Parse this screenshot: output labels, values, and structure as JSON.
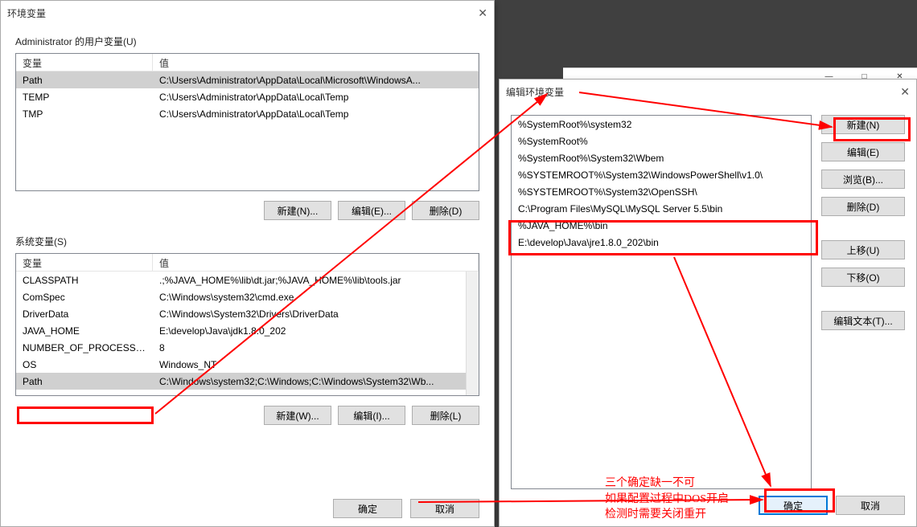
{
  "dialog1": {
    "title": "环境变量",
    "user_section_label": "Administrator 的用户变量(U)",
    "user_vars": {
      "col_name": "变量",
      "col_value": "值",
      "rows": [
        {
          "name": "Path",
          "value": "C:\\Users\\Administrator\\AppData\\Local\\Microsoft\\WindowsA...",
          "selected": true
        },
        {
          "name": "TEMP",
          "value": "C:\\Users\\Administrator\\AppData\\Local\\Temp"
        },
        {
          "name": "TMP",
          "value": "C:\\Users\\Administrator\\AppData\\Local\\Temp"
        }
      ]
    },
    "user_buttons": {
      "new": "新建(N)...",
      "edit": "编辑(E)...",
      "delete": "删除(D)"
    },
    "sys_section_label": "系统变量(S)",
    "sys_vars": {
      "col_name": "变量",
      "col_value": "值",
      "rows": [
        {
          "name": "CLASSPATH",
          "value": ".;%JAVA_HOME%\\lib\\dt.jar;%JAVA_HOME%\\lib\\tools.jar"
        },
        {
          "name": "ComSpec",
          "value": "C:\\Windows\\system32\\cmd.exe"
        },
        {
          "name": "DriverData",
          "value": "C:\\Windows\\System32\\Drivers\\DriverData"
        },
        {
          "name": "JAVA_HOME",
          "value": "E:\\develop\\Java\\jdk1.8.0_202"
        },
        {
          "name": "NUMBER_OF_PROCESSORS",
          "value": "8"
        },
        {
          "name": "OS",
          "value": "Windows_NT"
        },
        {
          "name": "Path",
          "value": "C:\\Windows\\system32;C:\\Windows;C:\\Windows\\System32\\Wb...",
          "selected": true
        }
      ]
    },
    "sys_buttons": {
      "new": "新建(W)...",
      "edit": "编辑(I)...",
      "delete": "删除(L)"
    },
    "ok": "确定",
    "cancel": "取消"
  },
  "dialog2": {
    "title": "编辑环境变量",
    "items": [
      "%SystemRoot%\\system32",
      "%SystemRoot%",
      "%SystemRoot%\\System32\\Wbem",
      "%SYSTEMROOT%\\System32\\WindowsPowerShell\\v1.0\\",
      "%SYSTEMROOT%\\System32\\OpenSSH\\",
      "C:\\Program Files\\MySQL\\MySQL Server 5.5\\bin",
      "%JAVA_HOME%\\bin",
      "E:\\develop\\Java\\jre1.8.0_202\\bin"
    ],
    "side_buttons": {
      "new": "新建(N)",
      "edit": "编辑(E)",
      "browse": "浏览(B)...",
      "delete": "删除(D)",
      "up": "上移(U)",
      "down": "下移(O)",
      "edit_text": "编辑文本(T)..."
    },
    "ok": "确定",
    "cancel": "取消"
  },
  "annotations": {
    "note1": "三个确定缺一不可",
    "note2": "如果配置过程中DOS开启",
    "note3": "检测时需要关闭重开"
  }
}
